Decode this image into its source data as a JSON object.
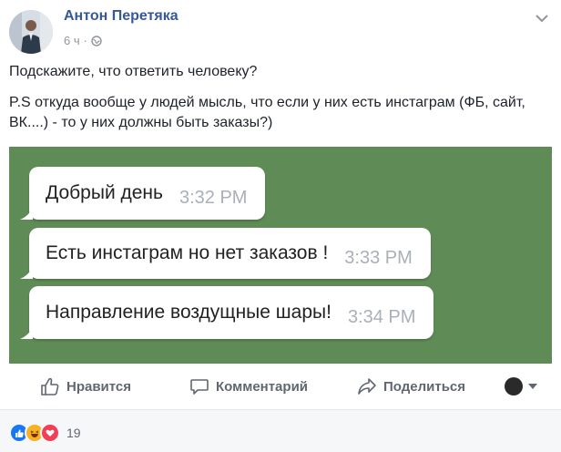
{
  "author": {
    "name": "Антон Перетяка",
    "time": "6 ч",
    "separator": "·"
  },
  "post": {
    "line1": "Подскажите, что ответить человеку?",
    "line2": "P.S откуда вообще у людей мысль, что если у них есть инстаграм (ФБ, сайт, ВК....) - то у них должны быть заказы?)"
  },
  "chat_image": {
    "background_color": "#5f8b57",
    "messages": [
      {
        "text": "Добрый день",
        "time": "3:32 PM"
      },
      {
        "text": "Есть инстаграм но нет заказов !",
        "time": "3:33 PM"
      },
      {
        "text": "Направление воздущные шары!",
        "time": "3:34 PM"
      }
    ]
  },
  "actions": {
    "like": "Нравится",
    "comment": "Комментарий",
    "share": "Поделиться"
  },
  "reactions": {
    "icons": [
      "like-reaction-icon",
      "haha-reaction-icon",
      "love-reaction-icon"
    ],
    "count": "19"
  },
  "colors": {
    "link_blue": "#365899",
    "like_blue": "#1877f2",
    "haha_yellow": "#f7b125",
    "love_red": "#f33e58"
  }
}
